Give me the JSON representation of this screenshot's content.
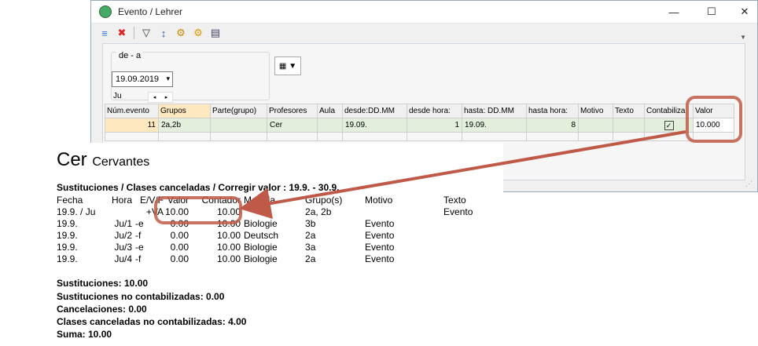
{
  "window": {
    "title": "Evento / Lehrer",
    "controls": {
      "min": "—",
      "max": "☐",
      "close": "✕"
    }
  },
  "toolbar": {
    "icons": [
      "list-icon",
      "delete-icon",
      "filter-icon",
      "sort-icon",
      "settings-icon",
      "gear-icon",
      "report-icon"
    ],
    "glyphs": [
      "≡",
      "✖",
      "▽",
      "↕",
      "⚙",
      "⚙",
      "▤"
    ]
  },
  "filter": {
    "group_label": "de - a",
    "date_value": "19.09.2019",
    "weekday": "Ju",
    "spin_left": "◂",
    "spin_right": "▸",
    "cal_glyph": "▦",
    "cal_chevron": "▼"
  },
  "grid": {
    "headers": [
      "Núm.evento",
      "Grupos",
      "Parte(grupo)",
      "Profesores",
      "Aula",
      "desde:DD.MM",
      "desde hora:",
      "hasta: DD.MM",
      "hasta hora:",
      "Motivo",
      "Texto",
      "Contabiliza",
      "Valor"
    ],
    "row": {
      "num": "11",
      "grupos": "2a,2b",
      "parte": "",
      "profesores": "Cer",
      "aula": "",
      "desde_dd": "19.09.",
      "desde_hora": "1",
      "hasta_dd": "19.09.",
      "hasta_hora": "8",
      "motivo": "",
      "texto": "",
      "contabiliza": "✓",
      "valor": "10.000"
    }
  },
  "report": {
    "abbr": "Cer",
    "full_name": "Cervantes",
    "subtitle": "Sustituciones / Clases canceladas / Corregir valor : 19.9. - 30.9.",
    "headers": [
      "Fecha",
      "Hora",
      "E/V/F",
      "Valor",
      "Contador",
      "Materia",
      "Grupo(s)",
      "Motivo",
      "Texto"
    ],
    "rows": [
      [
        "19.9. / Ju",
        "",
        "+VA",
        "10.00",
        "10.00",
        "",
        "2a, 2b",
        "",
        "Evento"
      ],
      [
        "19.9.",
        "Ju/1",
        "-e",
        "0.00",
        "10.00",
        "Biologie",
        "3b",
        "Evento",
        ""
      ],
      [
        "19.9.",
        "Ju/2",
        "-f",
        "0.00",
        "10.00",
        "Deutsch",
        "2a",
        "Evento",
        ""
      ],
      [
        "19.9.",
        "Ju/3",
        "-e",
        "0.00",
        "10.00",
        "Biologie",
        "3a",
        "Evento",
        ""
      ],
      [
        "19.9.",
        "Ju/4",
        "-f",
        "0.00",
        "10.00",
        "Biologie",
        "2a",
        "Evento",
        ""
      ]
    ],
    "summary": [
      "Sustituciones: 10.00",
      "Sustituciones no contabilizadas: 0.00",
      "Cancelaciones: 0.00",
      "Clases canceladas no contabilizadas: 4.00",
      "Suma: 10.00"
    ]
  },
  "colors": {
    "highlight_ring": "#c05a48",
    "row_green": "#e4eedd",
    "header_orange": "#fde8c0"
  }
}
